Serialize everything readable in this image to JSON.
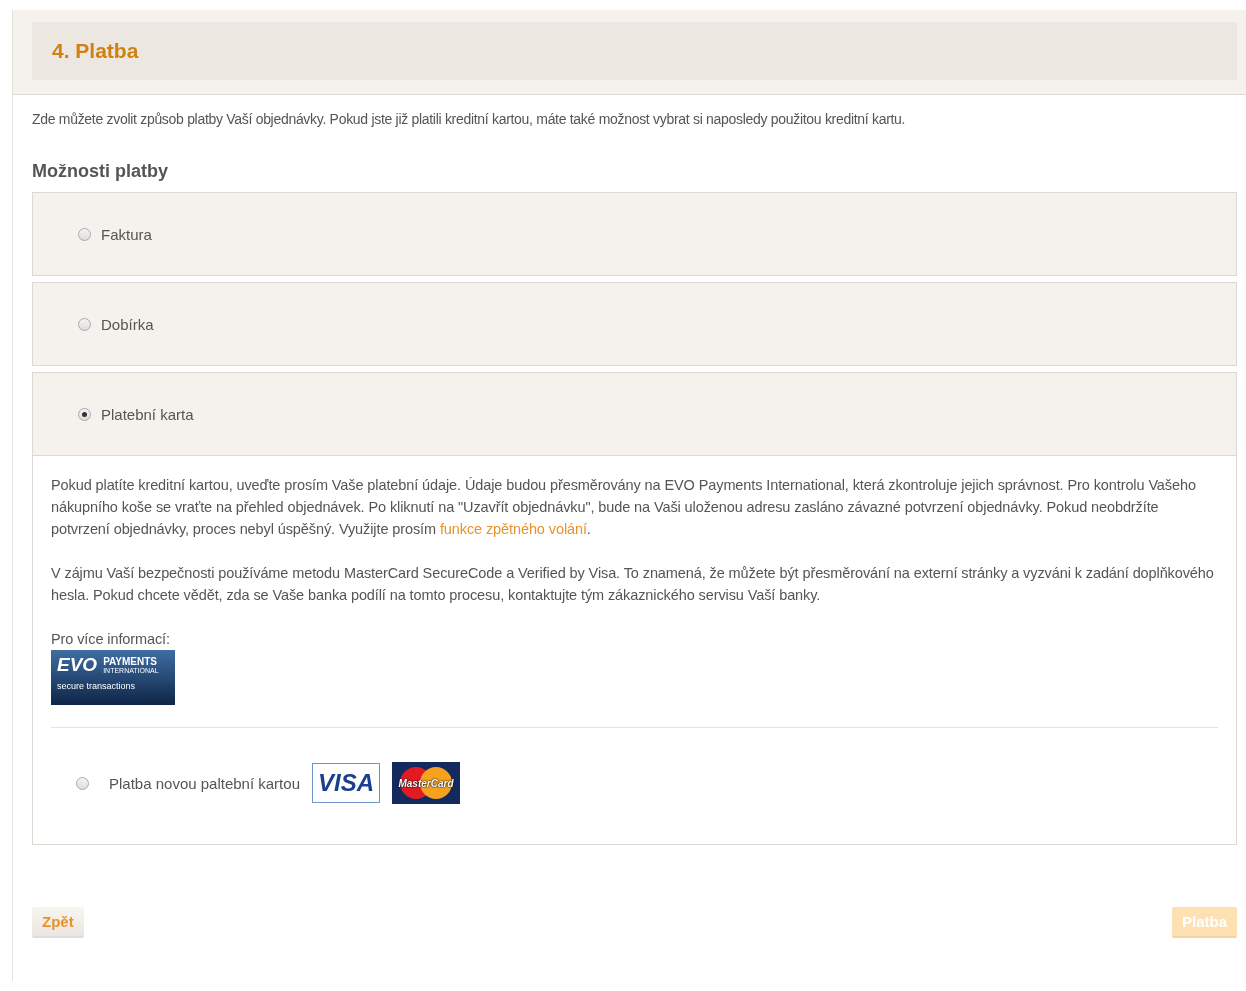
{
  "step_title": "4. Platba",
  "intro": "Zde můžete zvolit způsob platby Vaší objednávky. Pokud jste již platili kreditní kartou, máte také možnost vybrat si naposledy použitou kreditní kartu.",
  "options_heading": "Možnosti platby",
  "payment_options": [
    {
      "label": "Faktura",
      "selected": false,
      "expanded": false
    },
    {
      "label": "Dobírka",
      "selected": false,
      "expanded": false
    },
    {
      "label": "Platební karta",
      "selected": true,
      "expanded": true
    }
  ],
  "card_details": {
    "paragraph_1": "Pokud platíte kreditní kartou, uveďte prosím Vaše platební údaje. Údaje budou přesměrovány na EVO Payments International, která zkontroluje jejich správnost. Pro kontrolu Vašeho nákupního koše se vraťte na přehled objednávek. Po kliknutí na \"Uzavřít objednávku\", bude na Vaši uloženou adresu zasláno závazné potvrzení objednávky. Pokud neobdržíte potvrzení objednávky, proces nebyl úspěšný. Využijte prosím",
    "paragraph_1_link": "funkce zpětného volání",
    "paragraph_1_end": ".",
    "paragraph_2": "V zájmu Vaší bezpečnosti používáme metodu MasterCard SecureCode a Verified by Visa. To znamená, že můžete být přesměrování na externí stránky a vyzváni k zadání doplňkového hesla. Pokud chcete vědět, zda se Vaše banka podílí na tomto procesu, kontaktujte tým zákaznického servisu Vaší banky.",
    "more_info": "Pro více informací:",
    "evo_logo": {
      "mark": "EVO",
      "name": "PAYMENTS",
      "subname": "INTERNATIONAL",
      "tagline": "secure transactions"
    },
    "new_card": {
      "label": "Platba novou paltební kartou",
      "selected": false,
      "visa": "VISA",
      "mastercard": "MasterCard"
    }
  },
  "buttons": [
    {
      "label": "Zpět",
      "disabled": false
    },
    {
      "label": "Platba",
      "disabled": true
    }
  ]
}
